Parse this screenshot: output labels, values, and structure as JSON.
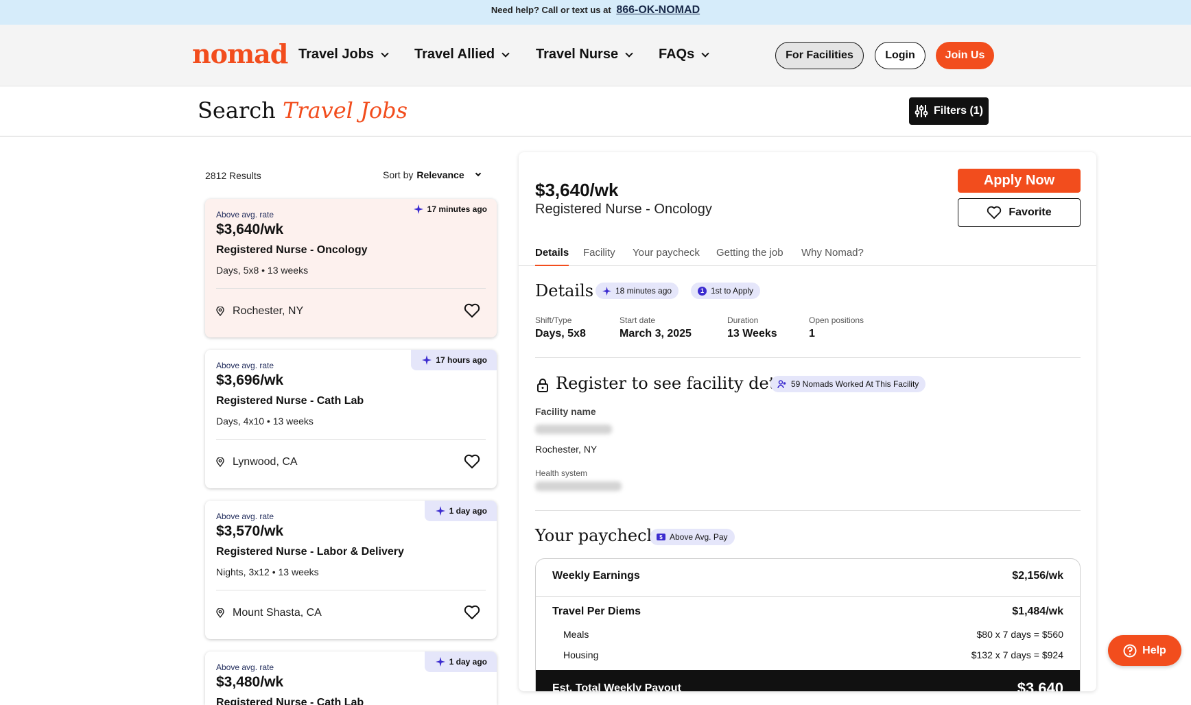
{
  "topbar": {
    "text": "Need help? Call or text us at",
    "phone": "866-OK-NOMAD"
  },
  "nav": {
    "logo": "nomad",
    "items": [
      {
        "label": "Travel Jobs"
      },
      {
        "label": "Travel Allied"
      },
      {
        "label": "Travel Nurse"
      },
      {
        "label": "FAQs"
      }
    ],
    "for_facilities": "For Facilities",
    "login": "Login",
    "join": "Join Us"
  },
  "search": {
    "title_plain": "Search",
    "title_accent": "Travel Jobs",
    "filters_label": "Filters (1)"
  },
  "results": {
    "count": "2812 Results",
    "sort_prefix": "Sort by",
    "sort_value": "Relevance"
  },
  "jobs": [
    {
      "badge": "Above avg. rate",
      "price": "$3,640/wk",
      "title": "Registered Nurse - Oncology",
      "meta": "Days, 5x8 • 13 weeks",
      "location": "Rochester, NY",
      "posted": "17 minutes ago",
      "selected": true
    },
    {
      "badge": "Above avg. rate",
      "price": "$3,696/wk",
      "title": "Registered Nurse - Cath Lab",
      "meta": "Days, 4x10 • 13 weeks",
      "location": "Lynwood, CA",
      "posted": "17 hours ago"
    },
    {
      "badge": "Above avg. rate",
      "price": "$3,570/wk",
      "title": "Registered Nurse - Labor & Delivery",
      "meta": "Nights, 3x12 • 13 weeks",
      "location": "Mount Shasta, CA",
      "posted": "1 day ago"
    },
    {
      "badge": "Above avg. rate",
      "price": "$3,480/wk",
      "title": "Registered Nurse - Cath Lab",
      "meta": "",
      "location": "",
      "posted": "1 day ago"
    }
  ],
  "detail": {
    "price": "$3,640/wk",
    "title": "Registered Nurse - Oncology",
    "apply": "Apply Now",
    "favorite": "Favorite",
    "tabs": [
      {
        "label": "Details"
      },
      {
        "label": "Facility"
      },
      {
        "label": "Your paycheck"
      },
      {
        "label": "Getting the job"
      },
      {
        "label": "Why Nomad?"
      }
    ],
    "details": {
      "heading": "Details",
      "posted_chip": "18 minutes ago",
      "first_chip_num": "1",
      "first_chip": "1st to Apply",
      "stats": [
        {
          "label": "Shift/Type",
          "value": "Days, 5x8"
        },
        {
          "label": "Start date",
          "value": "March 3, 2025"
        },
        {
          "label": "Duration",
          "value": "13 Weeks"
        },
        {
          "label": "Open positions",
          "value": "1"
        }
      ]
    },
    "facility": {
      "heading": "Register to see facility details",
      "chip": "59 Nomads Worked At This Facility",
      "name_label": "Facility name",
      "city": "Rochester, NY",
      "health_label": "Health system"
    },
    "paycheck": {
      "heading": "Your paycheck",
      "chip_icon": "$",
      "chip": "Above Avg. Pay",
      "weekly_label": "Weekly Earnings",
      "weekly_value": "$2,156/wk",
      "perdiem_label": "Travel Per Diems",
      "perdiem_value": "$1,484/wk",
      "meals_label": "Meals",
      "meals_value": "$80 x 7 days = $560",
      "housing_label": "Housing",
      "housing_value": "$132 x 7 days = $924",
      "total_label": "Est. Total Weekly Payout",
      "total_value": "$3,640"
    }
  },
  "help": "Help",
  "colors": {
    "brand": "#f24d1d",
    "chip": "#e5e6fa",
    "accent_purple": "#3b2bcf",
    "topbar": "#d6ecfa"
  }
}
